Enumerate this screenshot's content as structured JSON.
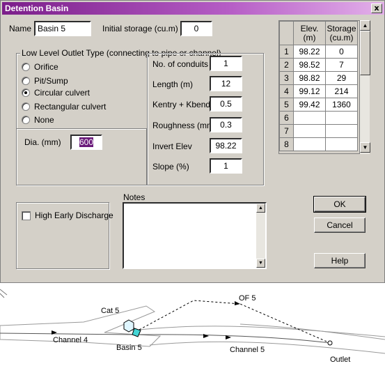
{
  "window": {
    "title": "Detention Basin",
    "close_label": "x"
  },
  "name": {
    "label": "Name",
    "value": "Basin 5"
  },
  "initial_storage": {
    "label": "Initial storage (cu.m)",
    "value": "0"
  },
  "outlet_group": {
    "title": "Low Level Outlet Type (connecting to pipe or channel)",
    "options": [
      {
        "label": "Orifice",
        "selected": false
      },
      {
        "label": "Pit/Sump",
        "selected": false
      },
      {
        "label": "Circular culvert",
        "selected": true
      },
      {
        "label": "Rectangular culvert",
        "selected": false
      },
      {
        "label": "None",
        "selected": false
      }
    ],
    "dia_label": "Dia. (mm)",
    "dia_value": "600"
  },
  "params": {
    "conduits": {
      "label": "No. of conduits",
      "value": "1"
    },
    "length": {
      "label": "Length (m)",
      "value": "12"
    },
    "kentry": {
      "label": "Kentry + Kbends",
      "value": "0.5"
    },
    "roughness": {
      "label": "Roughness (mm)",
      "value": "0.3"
    },
    "invert": {
      "label": "Invert Elev",
      "value": "98.22"
    },
    "slope": {
      "label": "Slope (%)",
      "value": "1"
    }
  },
  "table": {
    "headers": [
      "Elev.",
      "(m)",
      "Storage",
      "(cu.m)"
    ],
    "rows": [
      {
        "n": "1",
        "elev": "98.22",
        "storage": "0"
      },
      {
        "n": "2",
        "elev": "98.52",
        "storage": "7"
      },
      {
        "n": "3",
        "elev": "98.82",
        "storage": "29"
      },
      {
        "n": "4",
        "elev": "99.12",
        "storage": "214"
      },
      {
        "n": "5",
        "elev": "99.42",
        "storage": "1360"
      },
      {
        "n": "6",
        "elev": "",
        "storage": ""
      },
      {
        "n": "7",
        "elev": "",
        "storage": ""
      },
      {
        "n": "8",
        "elev": "",
        "storage": ""
      }
    ]
  },
  "high_early": {
    "label": "High Early Discharge",
    "checked": false
  },
  "notes": {
    "label": "Notes",
    "value": ""
  },
  "buttons": {
    "ok": "OK",
    "cancel": "Cancel",
    "help": "Help"
  },
  "map": {
    "labels": {
      "cat": "Cat 5",
      "of": "OF 5",
      "channel4": "Channel 4",
      "basin": "Basin 5",
      "channel5": "Channel 5",
      "outlet": "Outlet"
    }
  }
}
